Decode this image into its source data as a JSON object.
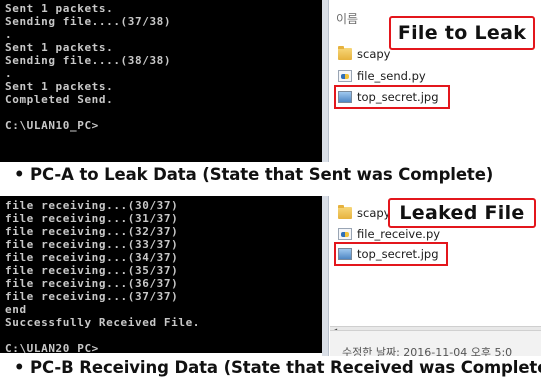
{
  "panel_a": {
    "console_lines": [
      "Sent 1 packets.",
      "Sending file....(37/38)",
      ".",
      "Sent 1 packets.",
      "Sending file....(38/38)",
      ".",
      "Sent 1 packets.",
      "Completed Send.",
      "",
      "C:\\ULAN10_PC>"
    ],
    "explorer": {
      "column_header": "이름",
      "files": [
        "scapy",
        "file_send.py",
        "top_secret.jpg"
      ],
      "callout": "File to Leak"
    },
    "caption": "PC-A to Leak Data (State that Sent was Complete)"
  },
  "panel_b": {
    "console_lines": [
      "file receiving...(30/37)",
      "file receiving...(31/37)",
      "file receiving...(32/37)",
      "file receiving...(33/37)",
      "file receiving...(34/37)",
      "file receiving...(35/37)",
      "file receiving...(36/37)",
      "file receiving...(37/37)",
      "end",
      "Successfully Received File.",
      "",
      "C:\\ULAN20_PC>"
    ],
    "explorer": {
      "files": [
        "scapy",
        "file_receive.py",
        "top_secret.jpg"
      ],
      "callout": "Leaked File",
      "status_text": "수정한 날짜: 2016-11-04 오후 5:0"
    },
    "caption": "PC-B Receiving Data (State that Received was Complete)"
  },
  "colors": {
    "console_bg": "#000000",
    "console_text": "#c8c8c8",
    "highlight_red": "#e3161c"
  }
}
